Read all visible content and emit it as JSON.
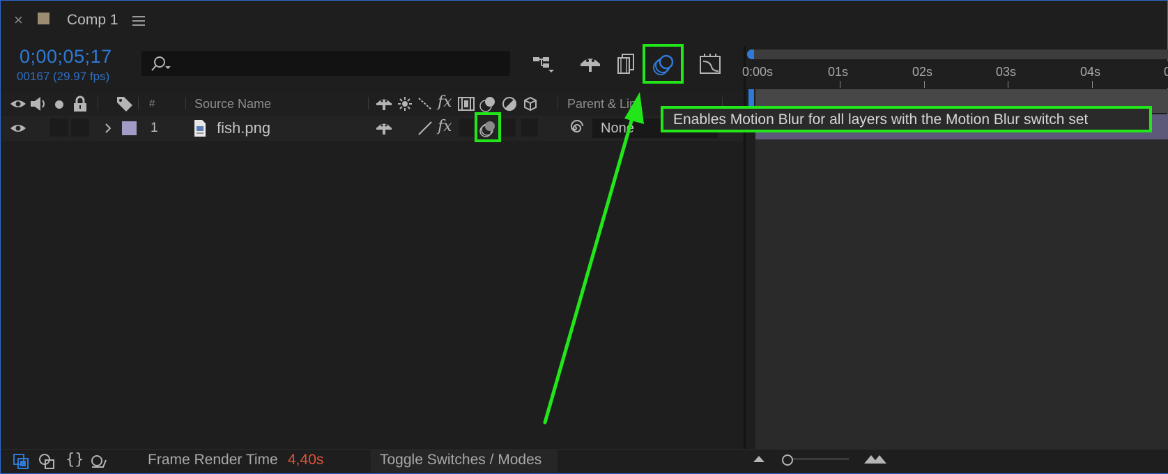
{
  "tab": {
    "close_glyph": "×",
    "title": "Comp 1",
    "swatch_color": "#9c8c72"
  },
  "timecode": {
    "current": "0;00;05;17",
    "frames": "00167 (29.97 fps)",
    "color": "#2f7ad6"
  },
  "search": {
    "placeholder": ""
  },
  "columns": {
    "number": "#",
    "source_name": "Source Name",
    "parent_link": "Parent & Link"
  },
  "layers": [
    {
      "index": "1",
      "name": "fish.png",
      "label_color": "#a09cc6",
      "parent": "None"
    }
  ],
  "ruler": {
    "ticks": [
      "0:00s",
      "01s",
      "02s",
      "03s",
      "04s",
      "0"
    ]
  },
  "tooltip": {
    "text": "Enables Motion Blur for all layers with the Motion Blur switch set"
  },
  "footer": {
    "frame_render_label": "Frame Render Time",
    "frame_render_value": "4,40s",
    "frame_render_color": "#e2533a",
    "toggle_label": "Toggle Switches / Modes"
  },
  "icons": [
    "close-icon",
    "hamburger-menu-icon",
    "search-icon",
    "composition-flowchart-icon",
    "draft-3d-icon",
    "frame-blending-icon",
    "motion-blur-icon",
    "graph-editor-icon",
    "eye-icon",
    "audio-icon",
    "solo-icon",
    "lock-icon",
    "label-tag-icon",
    "shy-icon",
    "collapse-icon",
    "quality-icon",
    "fx-icon",
    "adjustment-icon",
    "3d-layer-icon",
    "pickwhip-icon",
    "zoom-out-icon",
    "zoom-in-icon"
  ],
  "annotation_color": "#22e61a"
}
